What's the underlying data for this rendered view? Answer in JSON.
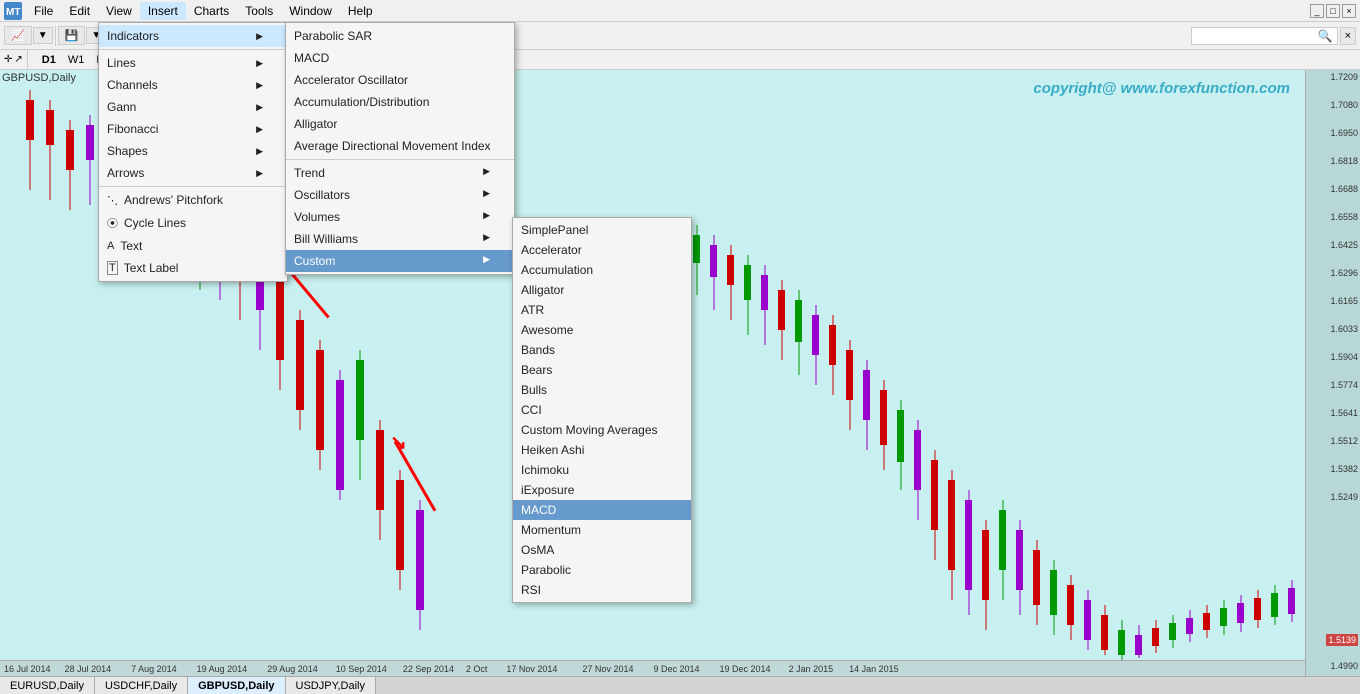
{
  "menubar": {
    "items": [
      "File",
      "Edit",
      "View",
      "Insert",
      "Charts",
      "Tools",
      "Window",
      "Help"
    ]
  },
  "insert_menu": {
    "items": [
      {
        "label": "Indicators",
        "has_submenu": true
      },
      {
        "label": "Lines",
        "has_submenu": true
      },
      {
        "label": "Channels",
        "has_submenu": true
      },
      {
        "label": "Gann",
        "has_submenu": true
      },
      {
        "label": "Fibonacci",
        "has_submenu": true
      },
      {
        "label": "Shapes",
        "has_submenu": true
      },
      {
        "label": "Arrows",
        "has_submenu": true
      },
      {
        "label": "Andrews' Pitchfork",
        "has_submenu": false
      },
      {
        "label": "Cycle Lines",
        "has_submenu": false
      },
      {
        "label": "Text",
        "has_submenu": false
      },
      {
        "label": "Text Label",
        "has_submenu": false
      }
    ]
  },
  "indicators_menu": {
    "items": [
      {
        "label": "Parabolic SAR",
        "has_submenu": false
      },
      {
        "label": "MACD",
        "has_submenu": false
      },
      {
        "label": "Accelerator Oscillator",
        "has_submenu": false
      },
      {
        "label": "Accumulation/Distribution",
        "has_submenu": false
      },
      {
        "label": "Alligator",
        "has_submenu": false
      },
      {
        "label": "Average Directional Movement Index",
        "has_submenu": false
      },
      {
        "label": "Trend",
        "has_submenu": true
      },
      {
        "label": "Oscillators",
        "has_submenu": true
      },
      {
        "label": "Volumes",
        "has_submenu": true
      },
      {
        "label": "Bill Williams",
        "has_submenu": true
      },
      {
        "label": "Custom",
        "has_submenu": true,
        "active": true
      }
    ]
  },
  "custom_menu": {
    "items": [
      {
        "label": "SimplePanel",
        "highlighted": false
      },
      {
        "label": "Accelerator",
        "highlighted": false
      },
      {
        "label": "Accumulation",
        "highlighted": false
      },
      {
        "label": "Alligator",
        "highlighted": false
      },
      {
        "label": "ATR",
        "highlighted": false
      },
      {
        "label": "Awesome",
        "highlighted": false
      },
      {
        "label": "Bands",
        "highlighted": false
      },
      {
        "label": "Bears",
        "highlighted": false
      },
      {
        "label": "Bulls",
        "highlighted": false
      },
      {
        "label": "CCI",
        "highlighted": false
      },
      {
        "label": "Custom Moving Averages",
        "highlighted": false
      },
      {
        "label": "Heiken Ashi",
        "highlighted": false
      },
      {
        "label": "Ichimoku",
        "highlighted": false
      },
      {
        "label": "iExposure",
        "highlighted": false
      },
      {
        "label": "MACD",
        "highlighted": true
      },
      {
        "label": "Momentum",
        "highlighted": false
      },
      {
        "label": "OsMA",
        "highlighted": false
      },
      {
        "label": "Parabolic",
        "highlighted": false
      },
      {
        "label": "RSI",
        "highlighted": false
      }
    ]
  },
  "chart": {
    "symbol": "GBPUSD,Daily",
    "copyright": "copyright@ www.forexfunction.com",
    "periods": [
      "D1",
      "W1",
      "MN"
    ],
    "active_period": "D1",
    "price_levels": [
      "1.7209",
      "1.7080",
      "1.6950",
      "1.6818",
      "1.6688",
      "1.6558",
      "1.6425",
      "1.6296",
      "1.6165",
      "1.6033",
      "1.5904",
      "1.5774",
      "1.5641",
      "1.5512",
      "1.5382",
      "1.5249",
      "1.5139",
      "1.4990"
    ],
    "dates": [
      "16 Jul 2014",
      "28 Jul 2014",
      "7 Aug 2014",
      "19 Aug 2014",
      "29 Aug 2014",
      "10 Sep 2014",
      "22 Sep 2014",
      "2 Oct",
      "17 Nov 2014",
      "27 Nov 2014",
      "9 Dec 2014",
      "19 Dec 2014",
      "2 Jan 2015",
      "14 Jan 2015"
    ]
  },
  "tabs": [
    {
      "label": "EURUSD,Daily",
      "active": false
    },
    {
      "label": "USDCHF,Daily",
      "active": false
    },
    {
      "label": "GBPUSD,Daily",
      "active": true
    },
    {
      "label": "USDJPY,Daily",
      "active": false
    }
  ]
}
